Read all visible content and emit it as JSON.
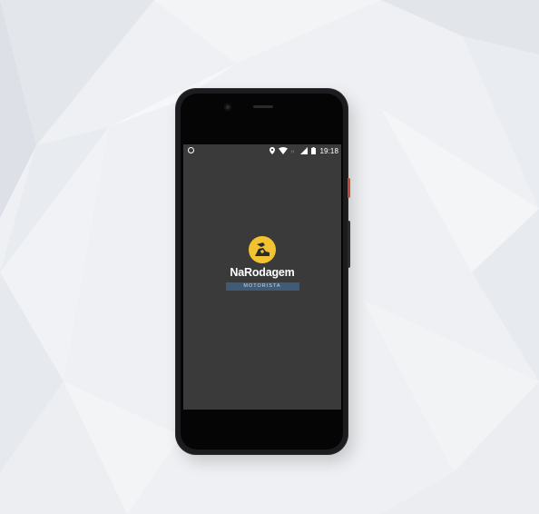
{
  "status_bar": {
    "time": "19:18",
    "icons": [
      "record-dot-icon",
      "location-icon",
      "wifi-icon",
      "signal-icon",
      "battery-icon"
    ]
  },
  "app": {
    "name": "NaRodagem",
    "subtitle": "MOTORISTA",
    "logo_icon": "truck-driver-icon"
  },
  "colors": {
    "screen_bg": "#3a3a3a",
    "logo_yellow": "#f2c230",
    "subtitle_bg": "#3f5b75",
    "scene_bg": "#eef0f3"
  }
}
